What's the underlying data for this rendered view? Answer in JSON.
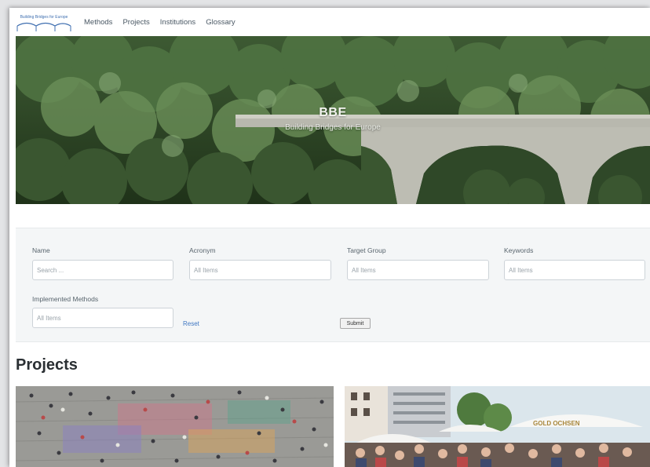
{
  "nav": {
    "logo_text": "Building Bridges for Europe",
    "links": [
      "Methods",
      "Projects",
      "Institutions",
      "Glossary"
    ]
  },
  "hero": {
    "title": "BBE",
    "subtitle": "Building Bridges for Europe"
  },
  "filters": {
    "name": {
      "label": "Name",
      "placeholder": "Search ..."
    },
    "acronym": {
      "label": "Acronym",
      "placeholder": "All Items"
    },
    "target_group": {
      "label": "Target Group",
      "placeholder": "All Items"
    },
    "keywords": {
      "label": "Keywords",
      "placeholder": "All Items"
    },
    "implemented_methods": {
      "label": "Implemented Methods",
      "placeholder": "All Items"
    },
    "reset_label": "Reset",
    "submit_label": "Submit"
  },
  "projects": {
    "title": "Projects",
    "cards": [
      {
        "image": "crowd-square-photo"
      },
      {
        "image": "festival-umbrellas-photo",
        "umbrella_text": "GOLD OCHSEN"
      }
    ]
  },
  "colors": {
    "link": "#3f77c2",
    "panel_bg": "#f4f6f7",
    "forest": "#2c4326"
  }
}
